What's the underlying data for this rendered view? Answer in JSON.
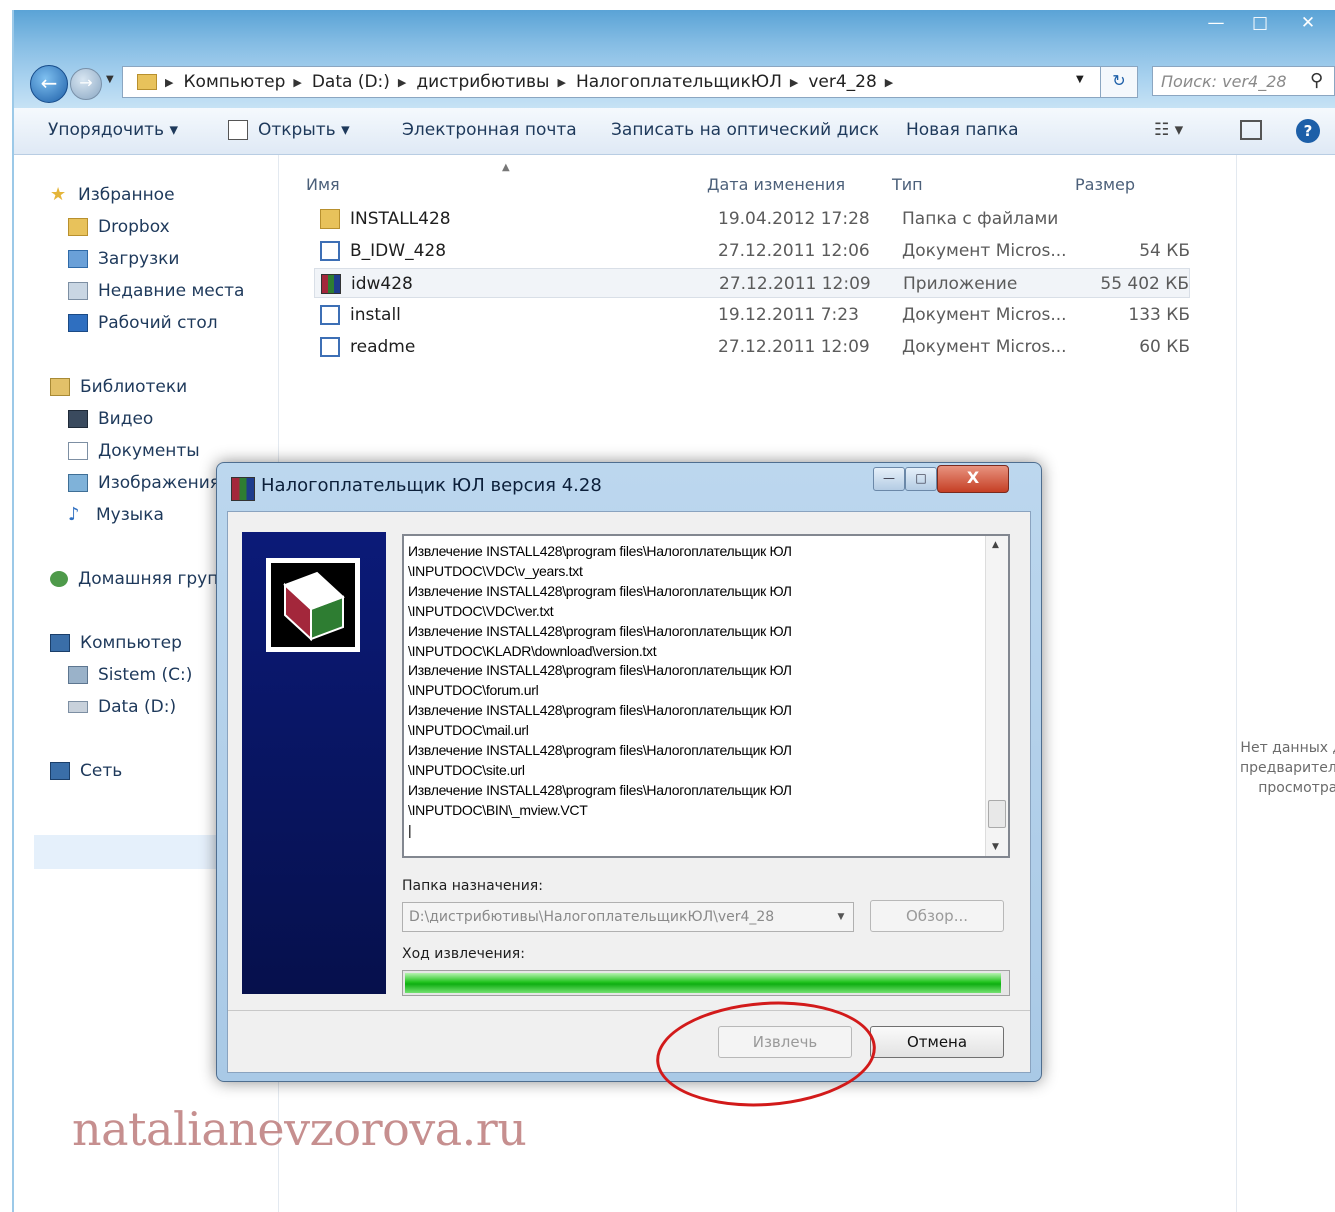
{
  "window": {
    "minimize": "—",
    "maximize": "□",
    "close": "✕"
  },
  "address": {
    "crumbs": [
      "Компьютер",
      "Data (D:)",
      "дистрибютивы",
      "НалогоплательщикЮЛ",
      "ver4_28"
    ],
    "separator": "▶",
    "search_placeholder": "Поиск: ver4_28"
  },
  "toolbar": {
    "organize": "Упорядочить ▾",
    "open": "Открыть ▾",
    "email": "Электронная почта",
    "burn": "Записать на оптический диск",
    "new_folder": "Новая папка",
    "views": "☷ ▾",
    "help": "?"
  },
  "nav": {
    "favorites": "Избранное",
    "dropbox": "Dropbox",
    "downloads": "Загрузки",
    "recent": "Недавние места",
    "desktop": "Рабочий стол",
    "libraries": "Библиотеки",
    "video": "Видео",
    "documents": "Документы",
    "images": "Изображения",
    "music": "Музыка",
    "homegroup": "Домашняя группа",
    "computer": "Компьютер",
    "drive_c": "Sistem (C:)",
    "drive_d": "Data (D:)",
    "network": "Сеть"
  },
  "columns": {
    "name": "Имя",
    "date": "Дата изменения",
    "type": "Тип",
    "size": "Размер"
  },
  "files": [
    {
      "name": "INSTALL428",
      "date": "19.04.2012 17:28",
      "type": "Папка с файлами",
      "size": ""
    },
    {
      "name": "B_IDW_428",
      "date": "27.12.2011 12:06",
      "type": "Документ Micros...",
      "size": "54 КБ"
    },
    {
      "name": "idw428",
      "date": "27.12.2011 12:09",
      "type": "Приложение",
      "size": "55 402 КБ"
    },
    {
      "name": "install",
      "date": "19.12.2011 7:23",
      "type": "Документ Micros...",
      "size": "133 КБ"
    },
    {
      "name": "readme",
      "date": "27.12.2011 12:09",
      "type": "Документ Micros...",
      "size": "60 КБ"
    }
  ],
  "preview": {
    "text": "Нет данных для предварительного просмотра."
  },
  "dialog": {
    "title": "Налогоплательщик ЮЛ версия 4.28",
    "minimize": "—",
    "maximize": "□",
    "close": "X",
    "log": "Извлечение INSTALL428\\program files\\Налогоплательщик ЮЛ\n\\INPUTDOC\\VDC\\v_years.txt\nИзвлечение INSTALL428\\program files\\Налогоплательщик ЮЛ\n\\INPUTDOC\\VDC\\ver.txt\nИзвлечение INSTALL428\\program files\\Налогоплательщик ЮЛ\n\\INPUTDOC\\KLADR\\download\\version.txt\nИзвлечение INSTALL428\\program files\\Налогоплательщик ЮЛ\n\\INPUTDOC\\forum.url\nИзвлечение INSTALL428\\program files\\Налогоплательщик ЮЛ\n\\INPUTDOC\\mail.url\nИзвлечение INSTALL428\\program files\\Налогоплательщик ЮЛ\n\\INPUTDOC\\site.url\nИзвлечение INSTALL428\\program files\\Налогоплательщик ЮЛ\n\\INPUTDOC\\BIN\\_mview.VCT\n|",
    "dest_label": "Папка назначения:",
    "dest_value": "D:\\дистрибютивы\\НалогоплательщикЮЛ\\ver4_28",
    "browse": "Обзор...",
    "progress_label": "Ход извлечения:",
    "progress_fraction": 0.99,
    "extract": "Извлечь",
    "cancel": "Отмена"
  },
  "watermark": "natalianevzorova.ru",
  "colors": {
    "accent": "#1d5fa8",
    "progress": "#22c31f",
    "highlight": "#d21a1a",
    "dialog_side": "#0b1a78"
  }
}
